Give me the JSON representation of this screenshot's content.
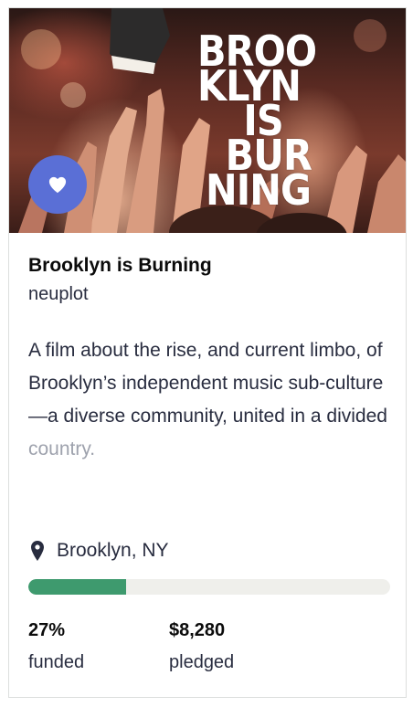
{
  "project": {
    "title": "Brooklyn is Burning",
    "creator": "neuplot",
    "blurb_main": "A film about the rise, and current limbo, of Brooklyn’s independent music sub-culture—a diverse community, united in a divided",
    "blurb_faded": "country.",
    "location": "Brooklyn, NY",
    "funded_percent_text": "27%",
    "funded_label": "funded",
    "pledged_amount": "$8,280",
    "pledged_label": "pledged",
    "progress_fraction": 0.27
  },
  "hero": {
    "title_lines": [
      "BROO",
      "KLYN",
      "IS",
      "BUR",
      "NING"
    ]
  },
  "colors": {
    "favorite_button": "#5a6fd6",
    "progress_fill": "#3e9a6e",
    "progress_track": "#efefeb"
  },
  "icons": {
    "favorite": "heart-icon",
    "location": "map-pin-icon"
  }
}
